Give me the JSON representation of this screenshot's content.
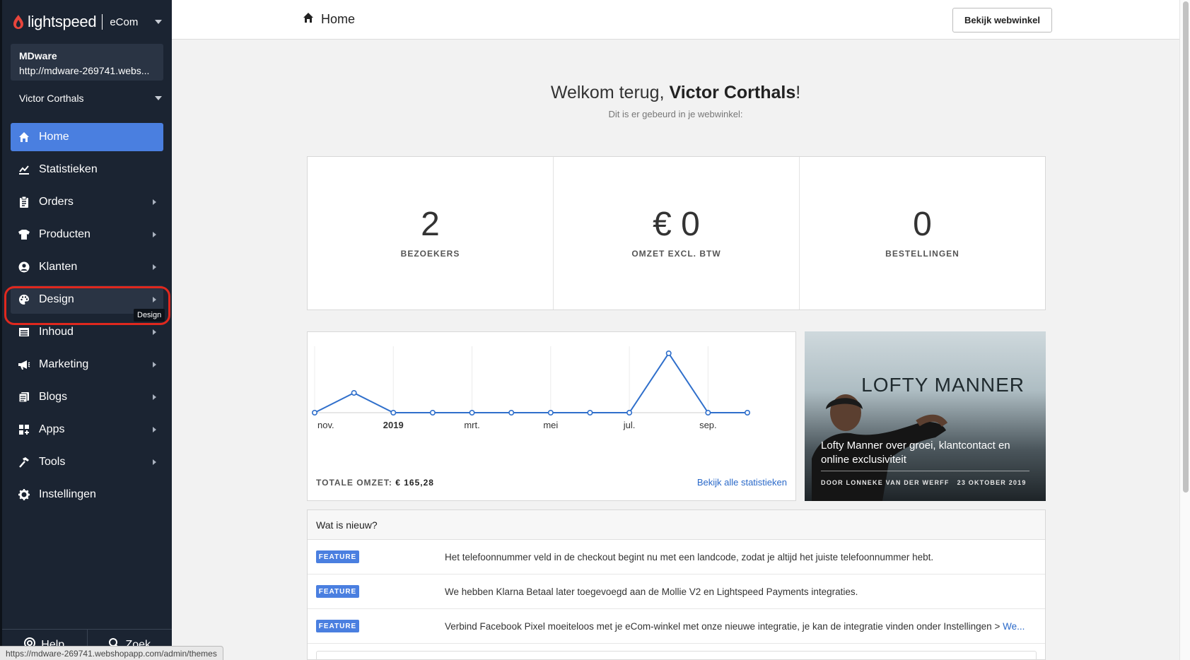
{
  "brand": {
    "name": "lightspeed",
    "product": "eCom"
  },
  "shop": {
    "name": "MDware",
    "url": "http://mdware-269741.webs..."
  },
  "user": {
    "name": "Victor Corthals"
  },
  "nav": [
    {
      "label": "Home",
      "icon": "home-icon"
    },
    {
      "label": "Statistieken",
      "icon": "chart-icon"
    },
    {
      "label": "Orders",
      "icon": "clipboard-icon"
    },
    {
      "label": "Producten",
      "icon": "shirt-icon"
    },
    {
      "label": "Klanten",
      "icon": "user-circle-icon"
    },
    {
      "label": "Design",
      "icon": "palette-icon"
    },
    {
      "label": "Inhoud",
      "icon": "content-icon"
    },
    {
      "label": "Marketing",
      "icon": "megaphone-icon"
    },
    {
      "label": "Blogs",
      "icon": "blog-icon"
    },
    {
      "label": "Apps",
      "icon": "apps-icon"
    },
    {
      "label": "Tools",
      "icon": "hammer-icon"
    },
    {
      "label": "Instellingen",
      "icon": "gear-icon"
    }
  ],
  "tooltip": "Design",
  "footer": {
    "help": "Help",
    "search": "Zoek"
  },
  "status_url": "https://mdware-269741.webshopapp.com/admin/themes",
  "topbar": {
    "title": "Home",
    "view_shop": "Bekijk webwinkel"
  },
  "welcome": {
    "prefix": "Welkom terug, ",
    "name": "Victor Corthals",
    "suffix": "!",
    "subtitle": "Dit is er gebeurd in je webwinkel:"
  },
  "stats": [
    {
      "value": "2",
      "label": "BEZOEKERS"
    },
    {
      "value": "€ 0",
      "label": "OMZET EXCL. BTW"
    },
    {
      "value": "0",
      "label": "BESTELLINGEN"
    }
  ],
  "chart_data": {
    "type": "line",
    "tick_labels": [
      "nov.",
      "2019",
      "mrt.",
      "mei",
      "jul.",
      "sep."
    ],
    "values": [
      0,
      1,
      0,
      0,
      0,
      0,
      0,
      0,
      0,
      3,
      0,
      0
    ],
    "grid": true,
    "color": "#2f6fcb"
  },
  "chart_footer": {
    "label": "TOTALE OMZET: ",
    "value": "€ 165,28",
    "link": "Bekijk alle statistieken"
  },
  "blog": {
    "brand": "LOFTY MANNER",
    "title": "Lofty Manner over groei, klantcontact en online exclusiviteit",
    "author": "DOOR LONNEKE VAN DER WERFF",
    "date": "23 OKTOBER 2019"
  },
  "news": {
    "title": "Wat is nieuw?",
    "items": [
      {
        "badge": "FEATURE",
        "text": "Het telefoonnummer veld in de checkout begint nu met een landcode, zodat je altijd het juiste telefoonnummer hebt.",
        "link": ""
      },
      {
        "badge": "FEATURE",
        "text": "We hebben Klarna Betaal later toegevoegd aan de Mollie V2 en Lightspeed Payments integraties.",
        "link": ""
      },
      {
        "badge": "FEATURE",
        "text": "Verbind Facebook Pixel moeiteloos met je eCom-winkel met onze nieuwe integratie, je kan de integratie vinden onder Instellingen > ",
        "link": "We..."
      }
    ]
  },
  "colors": {
    "sidebar": "#1b2432",
    "accent": "#4a7fe0",
    "highlight": "#e0281e"
  }
}
